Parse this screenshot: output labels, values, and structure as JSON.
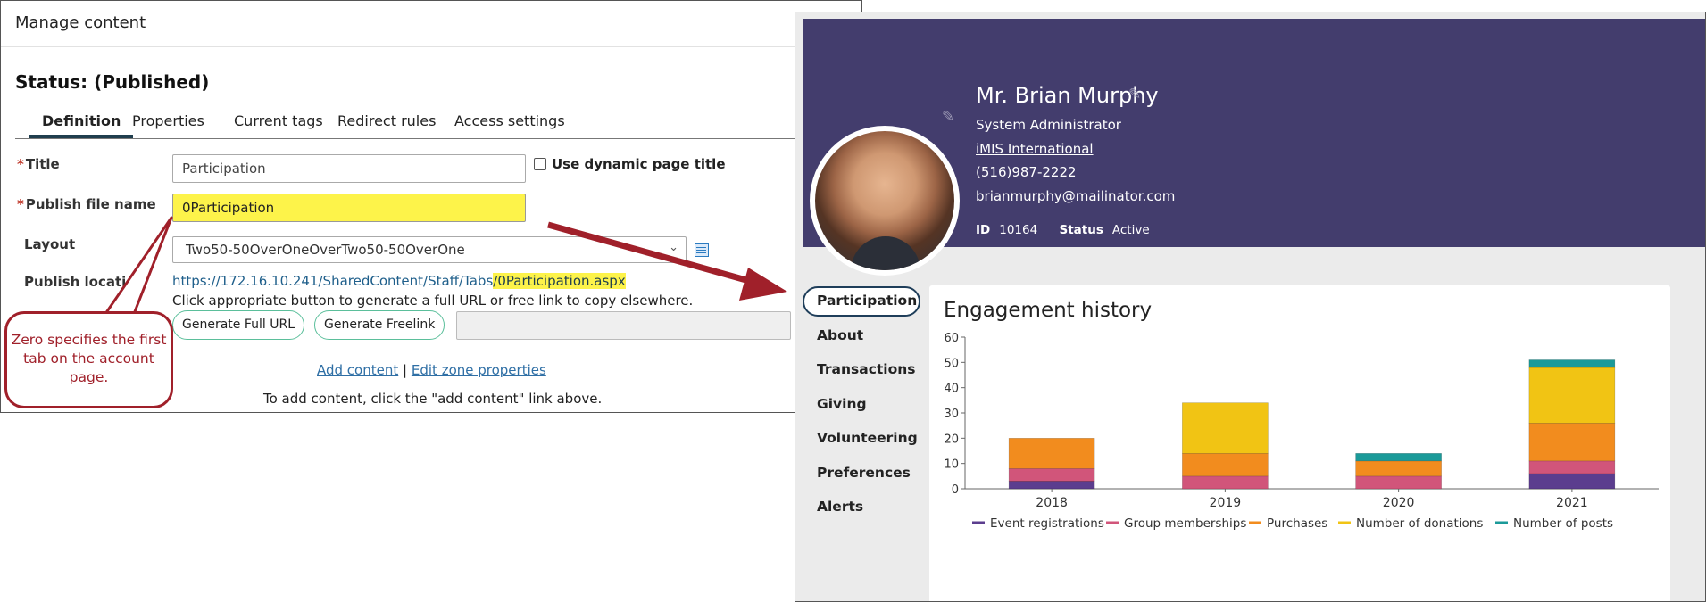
{
  "manage": {
    "title": "Manage content",
    "status": "Status: (Published)",
    "tabs": [
      {
        "label": "Definition"
      },
      {
        "label": "Properties"
      },
      {
        "label": "Current tags"
      },
      {
        "label": "Redirect rules"
      },
      {
        "label": "Access settings"
      }
    ],
    "required_mark": "*",
    "title_label": "Title",
    "title_value": "Participation",
    "dynamic_title_label": "Use dynamic page title",
    "publish_file_label": "Publish file name",
    "publish_file_value": "0Participation",
    "layout_label": "Layout",
    "layout_value": "Two50-50OverOneOverTwo50-50OverOne",
    "publish_location_label": "Publish location",
    "url_prefix": "https://172.16.10.241/SharedContent/Staff/Tabs",
    "url_file": "/0Participation.aspx",
    "help_text": "Click appropriate button to generate a full URL or free link to copy elsewhere.",
    "btn_full_url": "Generate Full URL",
    "btn_freelink": "Generate Freelink",
    "link_output_value": "",
    "add_content": "Add content",
    "separator": "|",
    "edit_zone": "Edit zone properties",
    "hint": "To add content, click the \"add content\" link above.",
    "callout": "Zero specifies the first tab on the account page."
  },
  "profile": {
    "name": "Mr. Brian Murphy",
    "role": "System Administrator",
    "company": "iMIS International",
    "phone": "(516)987-2222",
    "email": "brianmurphy@mailinator.com",
    "id_label": "ID",
    "id_value": "10164",
    "status_label": "Status",
    "status_value": "Active",
    "nav": [
      {
        "label": "Participation"
      },
      {
        "label": "About"
      },
      {
        "label": "Transactions"
      },
      {
        "label": "Giving"
      },
      {
        "label": "Volunteering"
      },
      {
        "label": "Preferences"
      },
      {
        "label": "Alerts"
      }
    ],
    "engagement_title": "Engagement history"
  },
  "chart_data": {
    "type": "bar",
    "stacked": true,
    "title": "Engagement history",
    "categories": [
      "2018",
      "2019",
      "2020",
      "2021"
    ],
    "series": [
      {
        "name": "Event registrations",
        "color": "#5b3d8e",
        "values": [
          3,
          0,
          0,
          6
        ]
      },
      {
        "name": "Group memberships",
        "color": "#d1557a",
        "values": [
          5,
          5,
          5,
          5
        ]
      },
      {
        "name": "Purchases",
        "color": "#f28c1e",
        "values": [
          12,
          9,
          6,
          15
        ]
      },
      {
        "name": "Number of donations",
        "color": "#f1c414",
        "values": [
          0,
          20,
          0,
          22
        ]
      },
      {
        "name": "Number of posts",
        "color": "#1b9a99",
        "values": [
          0,
          0,
          3,
          3
        ]
      }
    ],
    "ylim": [
      0,
      60
    ],
    "yticks": [
      0,
      10,
      20,
      30,
      40,
      50,
      60
    ],
    "legend": "bottom"
  }
}
